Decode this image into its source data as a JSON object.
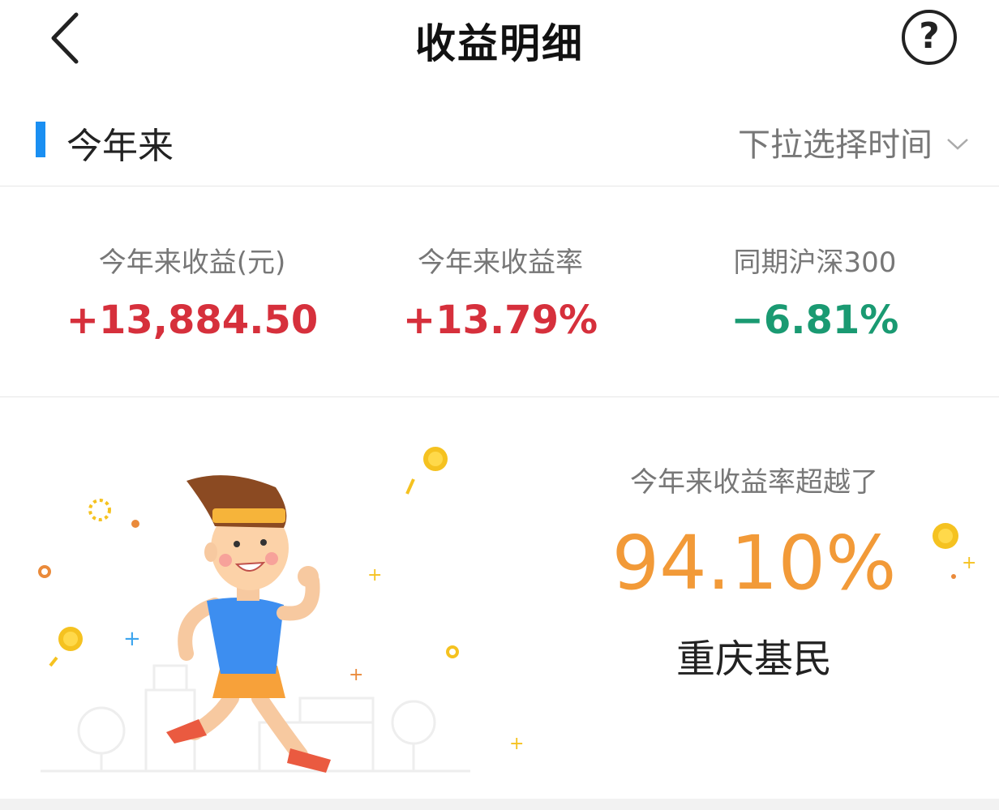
{
  "header": {
    "title": "收益明细",
    "help_symbol": "?"
  },
  "period": {
    "label": "今年来",
    "select_label": "下拉选择时间"
  },
  "stats": [
    {
      "label": "今年来收益(元)",
      "value": "+13,884.50"
    },
    {
      "label": "今年来收益率",
      "value": "+13.79%"
    },
    {
      "label": "同期沪深300",
      "value": "−6.81%"
    }
  ],
  "ranking": {
    "label": "今年来收益率超越了",
    "value": "94.10%",
    "name": "重庆基民"
  },
  "colors": {
    "accent": "#1a8ff2",
    "positive": "#d6303c",
    "negative": "#1a9a72",
    "highlight": "#f29a38"
  },
  "icons": [
    "back-arrow-icon",
    "help-icon",
    "chevron-down-icon"
  ]
}
